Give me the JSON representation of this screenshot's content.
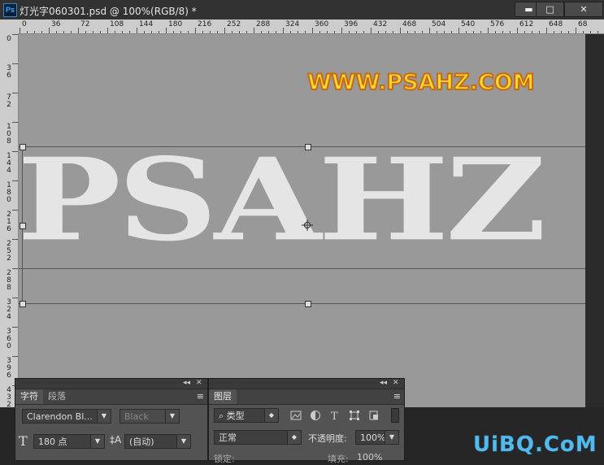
{
  "window": {
    "app_icon": "Ps",
    "title": "灯光字060301.psd @ 100%(RGB/8) *",
    "controls": {
      "minimize": "▬",
      "maximize": "□",
      "close": "✕"
    }
  },
  "ruler": {
    "horizontal": [
      "0",
      "36",
      "72",
      "108",
      "144",
      "180",
      "216",
      "252",
      "288",
      "324",
      "360",
      "396",
      "432",
      "468",
      "504",
      "540",
      "576",
      "612",
      "648",
      "68"
    ],
    "vertical": [
      "0",
      "3 6",
      "7 2",
      "1 0 8",
      "1 4 4",
      "1 8 0",
      "2 1 6",
      "2 5 2",
      "2 8 8",
      "3 2 4",
      "3 6 0",
      "3 9 6",
      "4 3 2"
    ]
  },
  "canvas": {
    "watermark": "WWW.PSAHZ.COM",
    "main_text": "PSAHZ",
    "background_color": "#999999",
    "text_color": "#e5e5e5",
    "watermark_fill": "#ffd830",
    "watermark_stroke": "#c96a10"
  },
  "character_panel": {
    "collapse": "◂◂",
    "close": "✕",
    "tabs": [
      {
        "label": "字符",
        "active": true
      },
      {
        "label": "段落",
        "active": false
      }
    ],
    "menu_icon": "≡",
    "font_family": "Clarendon Bl...",
    "font_style": "Black",
    "size_icon": "T",
    "font_size": "180 点",
    "leading_icon": "‡A",
    "leading": "(自动)"
  },
  "layers_panel": {
    "collapse": "◂◂",
    "close": "✕",
    "tabs": [
      {
        "label": "图层",
        "active": true
      }
    ],
    "menu_icon": "≡",
    "filter_icon": "⌕",
    "filter_kind": "类型",
    "filter_icons": [
      "image-filter-icon",
      "adjustment-filter-icon",
      "type-filter-icon",
      "shape-filter-icon",
      "smart-object-filter-icon"
    ],
    "blend_mode": "正常",
    "opacity_label": "不透明度:",
    "opacity_value": "100%",
    "lock_label": "锁定:",
    "fill_label": "填充:",
    "fill_value": "100%"
  },
  "site_watermark": "UiBQ.CoM"
}
